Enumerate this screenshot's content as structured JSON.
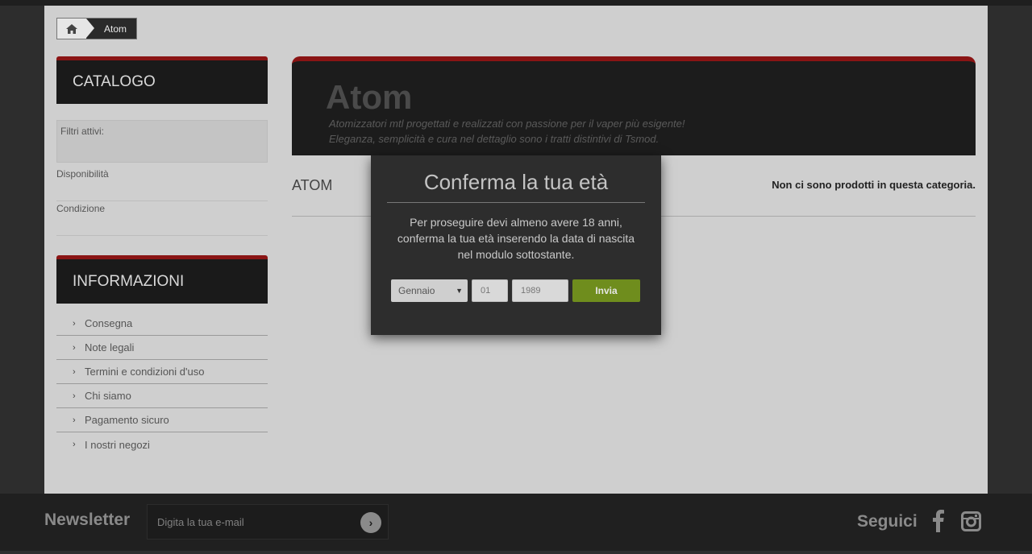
{
  "breadcrumb": {
    "home_icon": "home-icon",
    "current": "Atom"
  },
  "sidebar": {
    "catalog_title": "CATALOGO",
    "filters_label": "Filtri attivi:",
    "facets": [
      "Disponibilità",
      "Condizione"
    ],
    "info_title": "INFORMAZIONI",
    "info_items": [
      {
        "label": "Consegna"
      },
      {
        "label": "Note legali"
      },
      {
        "label": "Termini e condizioni d'uso"
      },
      {
        "label": "Chi siamo"
      },
      {
        "label": "Pagamento sicuro"
      },
      {
        "label": "I nostri negozi"
      }
    ]
  },
  "category": {
    "title": "Atom",
    "description_1": "Atomizzatori mtl progettati e realizzati con passione per il vaper più esigente!",
    "description_2": "Eleganza, semplicità e cura nel dettaglio sono i tratti distintivi di Tsmod.",
    "name": "ATOM",
    "empty_message": "Non ci sono prodotti in questa categoria."
  },
  "age_modal": {
    "title": "Conferma la tua età",
    "text": "Per proseguire devi almeno avere 18 anni, conferma la tua età inserendo la data di nascita nel modulo sottostante.",
    "month_selected": "Gennaio",
    "day_value": "01",
    "year_value": "1989",
    "submit_label": "Invia"
  },
  "footer": {
    "newsletter_title": "Newsletter",
    "newsletter_placeholder": "Digita la tua e-mail",
    "follow_title": "Seguici"
  },
  "colors": {
    "accent_red": "#8a1414",
    "submit_green": "#6f8d1d"
  }
}
